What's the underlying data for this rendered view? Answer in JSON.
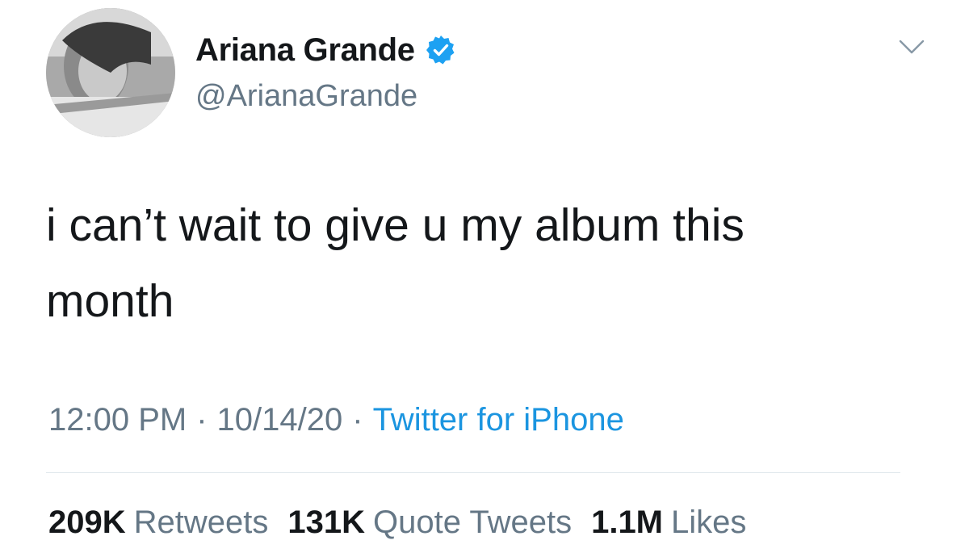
{
  "author": {
    "name": "Ariana Grande",
    "handle": "@ArianaGrande",
    "verified": true
  },
  "tweet": {
    "text_line1": "i can’t wait to give u my album this",
    "text_line2": "month"
  },
  "meta": {
    "time": "12:00 PM",
    "date": "10/14/20",
    "source": "Twitter for iPhone",
    "separator": "·"
  },
  "stats": {
    "retweets_count": "209K",
    "retweets_label": "Retweets",
    "quotes_count": "131K",
    "quotes_label": "Quote Tweets",
    "likes_count": "1.1M",
    "likes_label": "Likes"
  },
  "icons": {
    "verified": "verified-badge-icon",
    "caret": "chevron-down-icon"
  },
  "colors": {
    "text": "#14171a",
    "secondary": "#657786",
    "link": "#1b95e0",
    "verified": "#1da1f2",
    "divider": "#e1e8ed"
  }
}
